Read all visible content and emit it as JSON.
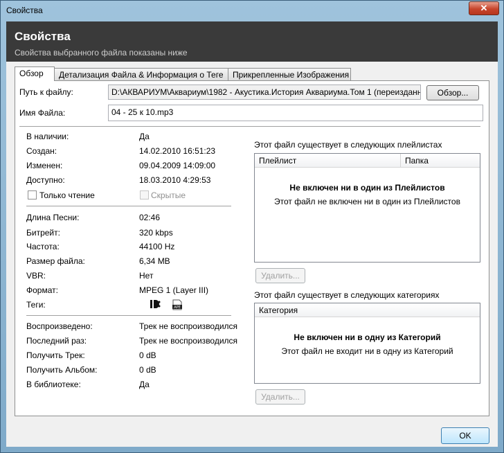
{
  "window": {
    "title": "Свойства",
    "close_glyph": "✕"
  },
  "header": {
    "title": "Свойства",
    "subtitle": "Свойства выбранного файла показаны ниже"
  },
  "tabs": [
    {
      "label": "Обзор",
      "active": true
    },
    {
      "label": "Детализация Файла & Информация о Теге",
      "active": false
    },
    {
      "label": "Прикрепленные Изображения",
      "active": false
    }
  ],
  "file": {
    "path_label": "Путь к файлу:",
    "path_value": "D:\\АКВАРИУМ\\Аквариум\\1982 - Акустика.История Аквариума.Том 1 (переизданне",
    "browse_label": "Обзор...",
    "name_label": "Имя Файла:",
    "name_value": "04 - 25 к 10.mp3"
  },
  "info": [
    {
      "label": "В наличии:",
      "value": "Да"
    },
    {
      "label": "Создан:",
      "value": "14.02.2010 16:51:23"
    },
    {
      "label": "Изменен:",
      "value": "09.04.2009 14:09:00"
    },
    {
      "label": "Доступно:",
      "value": "18.03.2010 4:29:53"
    }
  ],
  "checkboxes": {
    "readonly": "Только чтение",
    "hidden": "Скрытые"
  },
  "audio": [
    {
      "label": "Длина Песни:",
      "value": "02:46"
    },
    {
      "label": "Битрейт:",
      "value": "320 kbps"
    },
    {
      "label": "Частота:",
      "value": "44100 Hz"
    },
    {
      "label": "Размер файла:",
      "value": "6,34 MB"
    },
    {
      "label": "VBR:",
      "value": "Нет"
    },
    {
      "label": "Формат:",
      "value": "MPEG 1 (Layer III)"
    }
  ],
  "tags_label": "Теги:",
  "tag_icons": {
    "id3": "id3-tag-icon",
    "ape": "ape-tag-icon",
    "ape_text": "APE"
  },
  "playback": [
    {
      "label": "Воспроизведено:",
      "value": "Трек не воспроизводился"
    },
    {
      "label": "Последний раз:",
      "value": "Трек не воспроизводился"
    },
    {
      "label": "Получить Трек:",
      "value": "0 dB"
    },
    {
      "label": "Получить Альбом:",
      "value": "0 dB"
    },
    {
      "label": "В библиотеке:",
      "value": "Да"
    }
  ],
  "playlists": {
    "title": "Этот файл существует в следующих плейлистах",
    "col_playlist": "Плейлист",
    "col_folder": "Папка",
    "empty_bold": "Не включен ни в один из Плейлистов",
    "empty_normal": "Этот файл не включен ни в один из Плейлистов",
    "remove_label": "Удалить..."
  },
  "categories": {
    "title": "Этот файл существует в следующих категориях",
    "col_category": "Категория",
    "empty_bold": "Не включен ни в одну из Категорий",
    "empty_normal": "Этот файл не входит ни в одну из Категорий",
    "remove_label": "Удалить..."
  },
  "ok_label": "OK",
  "colors": {
    "header_bg": "#3a3a3a",
    "window_frame": "#8cb4d2",
    "close_red": "#c7452c"
  }
}
